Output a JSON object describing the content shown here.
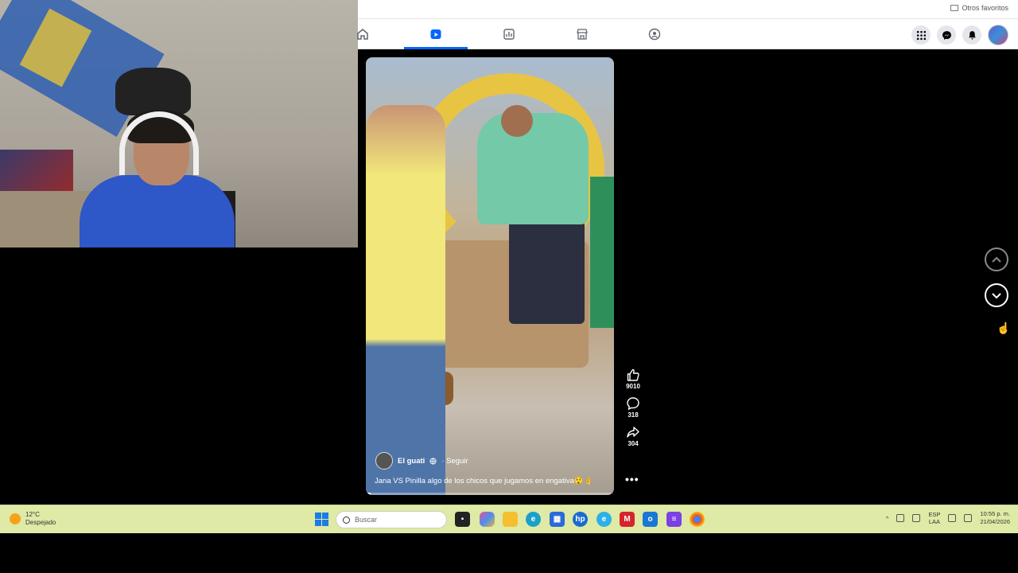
{
  "browser": {
    "bookmarks": {
      "other_favorites": "Otros favoritos"
    }
  },
  "facebook": {
    "nav_tabs": [
      {
        "name": "home",
        "icon": "home-icon",
        "active": false
      },
      {
        "name": "reels",
        "icon": "reels-icon",
        "active": true
      },
      {
        "name": "ads",
        "icon": "chart-icon",
        "active": false
      },
      {
        "name": "marketplace",
        "icon": "store-icon",
        "active": false
      },
      {
        "name": "groups",
        "icon": "groups-icon",
        "active": false
      }
    ],
    "accent": "#0866ff"
  },
  "reel": {
    "author": "El guati",
    "follow_label": "· Seguir",
    "caption": "Jana VS Pinilla algo de los chicos que jugamos en engativa😲👌",
    "likes": "9010",
    "comments": "318",
    "shares": "304",
    "more_label": "•••",
    "progress": 0.02
  },
  "taskbar": {
    "weather": {
      "temp": "12°C",
      "condition": "Despejado"
    },
    "search_placeholder": "Buscar",
    "apps": [
      "task-view-icon",
      "copilot-icon",
      "file-explorer-icon",
      "edge-icon",
      "store-icon",
      "hp-icon",
      "edge-beta-icon",
      "mcafee-icon",
      "outlook-icon",
      "clipchamp-icon",
      "chrome-icon"
    ],
    "tray": {
      "lang_top": "ESP",
      "lang_bottom": "LAA",
      "time": "10:55 p. m.",
      "date": "21/04/2026"
    }
  }
}
